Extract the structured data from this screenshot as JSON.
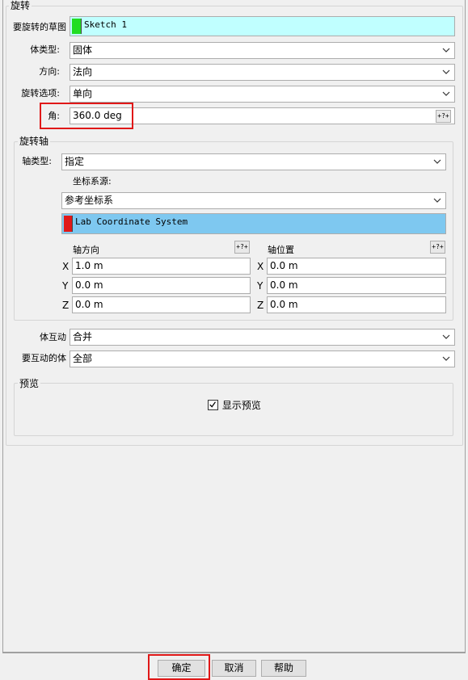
{
  "section_revolve": {
    "title": "旋转",
    "sketch_label": "要旋转的草图",
    "sketch_value": "Sketch 1",
    "sketch_color": "#22dd22",
    "body_type_label": "体类型:",
    "body_type_value": "固体",
    "direction_label": "方向:",
    "direction_value": "法向",
    "revolve_option_label": "旋转选项:",
    "revolve_option_value": "单向",
    "angle_label": "角:",
    "angle_value": "360.0 deg",
    "angle_tool": "+?+"
  },
  "section_axis": {
    "title": "旋转轴",
    "axis_type_label": "轴类型:",
    "axis_type_value": "指定",
    "coord_source_label": "坐标系源:",
    "coord_source_value": "参考坐标系",
    "coord_system_value": "Lab Coordinate System",
    "coord_system_color": "#e01818",
    "coord_system_bg": "#7ec8f0",
    "axis_direction_label": "轴方向",
    "axis_position_label": "轴位置",
    "tool_label": "+?+",
    "direction": [
      {
        "axis": "X",
        "value": "1.0 m"
      },
      {
        "axis": "Y",
        "value": "0.0 m"
      },
      {
        "axis": "Z",
        "value": "0.0 m"
      }
    ],
    "position": [
      {
        "axis": "X",
        "value": "0.0 m"
      },
      {
        "axis": "Y",
        "value": "0.0 m"
      },
      {
        "axis": "Z",
        "value": "0.0 m"
      }
    ]
  },
  "body_interaction": {
    "label": "体互动",
    "value": "合并",
    "bodies_label": "要互动的体",
    "bodies_value": "全部"
  },
  "preview": {
    "title": "预览",
    "checkbox_label": "显示预览",
    "checked": true
  },
  "footer": {
    "ok": "确定",
    "cancel": "取消",
    "help": "帮助"
  },
  "colors": {
    "highlight": "#e01818",
    "sketch_bg": "#c0ffff"
  }
}
